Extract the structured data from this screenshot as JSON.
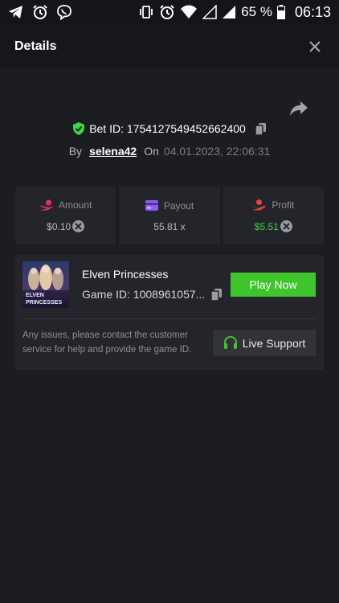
{
  "status_bar": {
    "battery_percent": "65 %",
    "time": "06:13",
    "left_icons": [
      "telegram-icon",
      "alarm-icon",
      "viber-icon"
    ],
    "right_icons": [
      "vibrate-icon",
      "alarm-icon",
      "wifi-icon",
      "signal-icon",
      "signal-icon",
      "battery-icon"
    ]
  },
  "header": {
    "title": "Details"
  },
  "bet": {
    "id_text": "Bet ID: 1754127549452662400",
    "by_label": "By",
    "username": "selena42",
    "on_label": "On",
    "date": "04.01.2023, 22:06:31"
  },
  "stats": {
    "amount": {
      "label": "Amount",
      "value": "$0.10"
    },
    "payout": {
      "label": "Payout",
      "value": "55.81 x"
    },
    "profit": {
      "label": "Profit",
      "value": "$5.51"
    }
  },
  "game": {
    "name": "Elven Princesses",
    "id_text": "Game ID: 1008961057...",
    "play_label": "Play Now",
    "thumb_text_1": "ELVEN",
    "thumb_text_2": "PRINCESSES"
  },
  "support": {
    "text": "Any issues, please contact the customer service for help and provide the game ID.",
    "button_label": "Live Support"
  },
  "colors": {
    "accent_green": "#3ec52b",
    "profit_green": "#3dd54a",
    "background": "#1c1d21",
    "card": "#24252a"
  }
}
